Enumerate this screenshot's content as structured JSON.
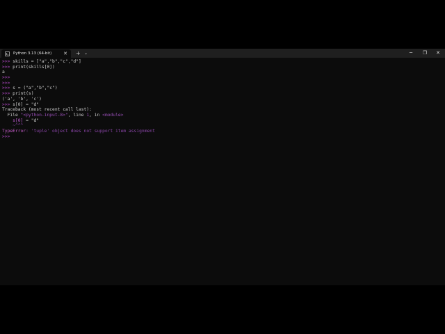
{
  "tab": {
    "title": "Python 3.13 (64-bit)",
    "close": "✕"
  },
  "toolbar": {
    "new_tab": "+",
    "dropdown": "⌄"
  },
  "window_controls": {
    "minimize": "─",
    "maximize": "❐",
    "close": "✕"
  },
  "terminal": {
    "prompt": ">>>",
    "lines": {
      "l1": " skills = [\"a\",\"b\",\"c\",\"d\"]",
      "l2": " print(skills[0])",
      "l3": "a",
      "l6": " s = (\"a\",\"b\",\"c\")",
      "l7": " print(s)",
      "l8": "('a', 'b', 'c')",
      "l9": " s[0] = \"d\"",
      "l10": "Traceback (most recent call last):",
      "l11_a": "  File ",
      "l11_file": "\"<python-input-8>\"",
      "l11_b": ", line ",
      "l11_line": "1",
      "l11_c": ", in ",
      "l11_mod": "<module>",
      "l12_indent": "    ",
      "l12_code": "s[0]",
      "l12_rest": " = \"d\"",
      "l13": "    ~^^^",
      "l14_type": "TypeError",
      "l14_msg": ": 'tuple' object does not support item assignment"
    }
  }
}
